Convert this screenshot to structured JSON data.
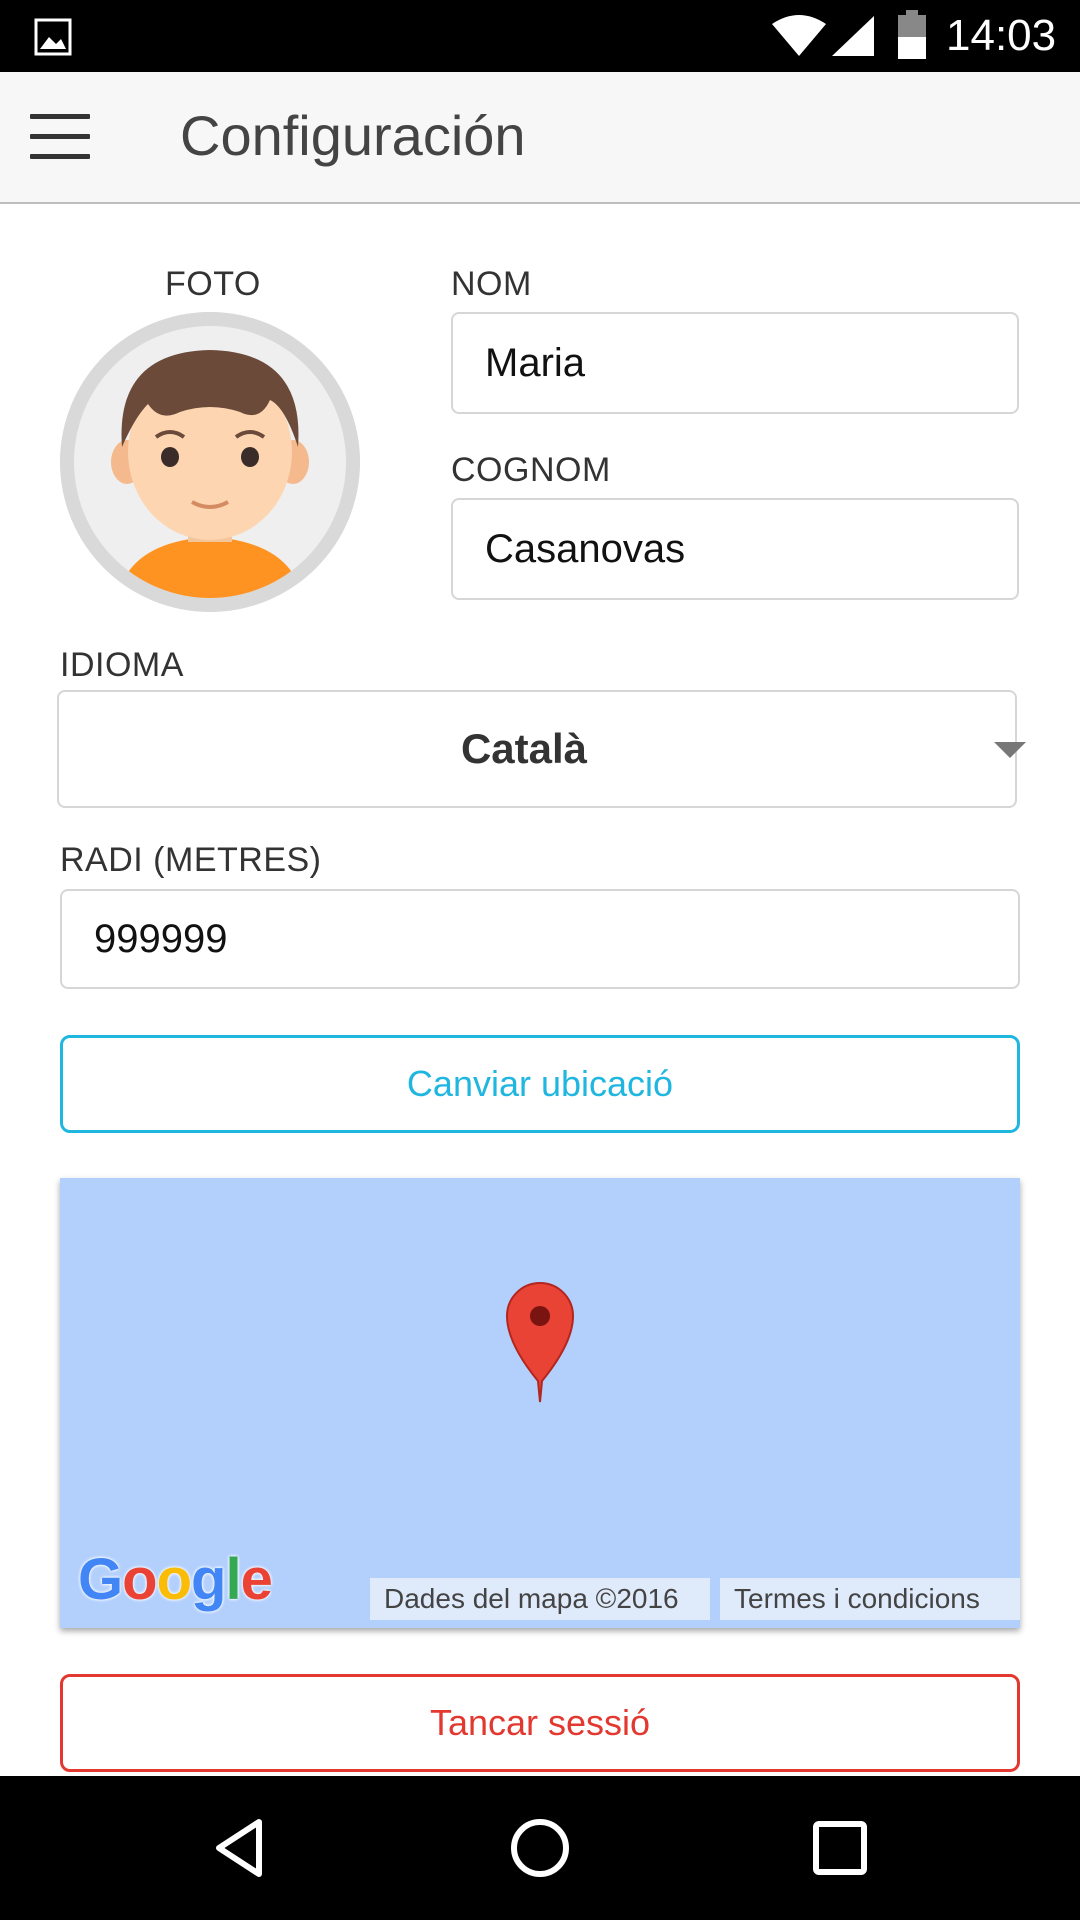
{
  "status_bar": {
    "time": "14:03",
    "icons": [
      "gallery-icon",
      "wifi-icon",
      "signal-icon",
      "battery-icon"
    ]
  },
  "app_bar": {
    "title": "Configuración",
    "menu_icon": "hamburger-menu-icon"
  },
  "profile": {
    "photo_label": "FOTO",
    "name_label": "NOM",
    "name_value": "Maria",
    "surname_label": "COGNOM",
    "surname_value": "Casanovas"
  },
  "language": {
    "label": "IDIOMA",
    "selected": "Català"
  },
  "radius": {
    "label": "RADI (METRES)",
    "value": "999999"
  },
  "buttons": {
    "change_location": "Canviar ubicació",
    "logout": "Tancar sessió"
  },
  "map": {
    "logo": "Google",
    "data_attribution": "Dades del mapa ©2016",
    "terms": "Termes i condicions",
    "pin_icon": "map-marker-icon"
  },
  "colors": {
    "accent": "#1fb6e0",
    "danger": "#e2382f",
    "map_water": "#b3d0fd"
  },
  "nav_bar": {
    "icons": [
      "back-icon",
      "home-icon",
      "recents-icon"
    ]
  }
}
